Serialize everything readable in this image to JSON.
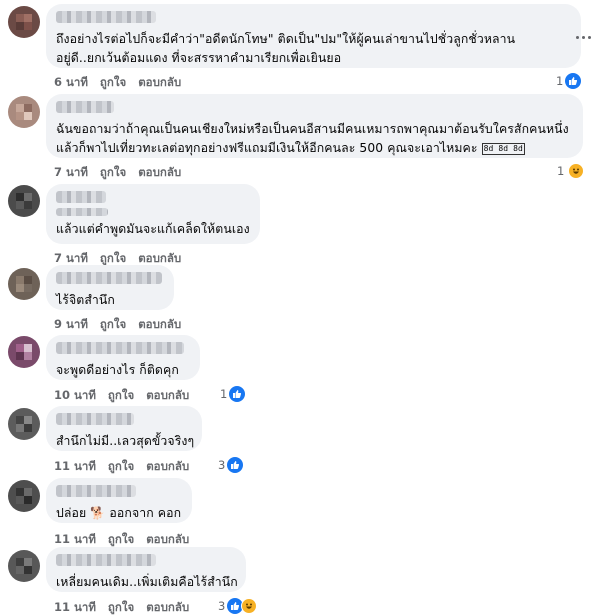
{
  "colors": {
    "bubble": "#f0f2f5",
    "meta": "#65676b",
    "like": "#1877f2",
    "haha": "#f7b125"
  },
  "comments": [
    {
      "lines": [
        "ถึงอย่างไรต่อไปก็จะมีคำว่า\"อดีตนักโทษ\" ติดเป็น\"ปม\"ให้ผู้คนเล่าขานไปชั่วลูกชั่วหลาน",
        "อยู่ดี..ยกเว้นต้อมแดง ที่จะสรรหาคำมาเรียกเพื่อเยินยอ"
      ],
      "time": "6 นาที",
      "like": "ถูกใจ",
      "reply": "ตอบกลับ",
      "reactions": "1",
      "reaction_icons": [
        "like-icon"
      ]
    },
    {
      "lines": [
        "ฉันขอถามว่าถ้าคุณเป็นคนเชียงใหม่หรือเป็นคนอีสานมีคนเหมารถพาคุณมาต้อนรับใครสักคนหนึ่ง",
        "แล้วก็พาไปเที่ยวทะเลต่อทุกอย่างฟรีแถมมีเงินให้อีกคนละ 500 คุณจะเอาไหมคะ"
      ],
      "glyph": "8d 8d 8d",
      "time": "7 นาที",
      "like": "ถูกใจ",
      "reply": "ตอบกลับ",
      "reactions": "1",
      "reaction_icons": [
        "haha-icon"
      ]
    },
    {
      "lines": [
        "แล้วแต่คำพูดมันจะแก้เคล็ดให้ตนเอง"
      ],
      "time": "7 นาที",
      "like": "ถูกใจ",
      "reply": "ตอบกลับ",
      "reactions": "",
      "reaction_icons": []
    },
    {
      "lines": [
        "ไร้จิตสำนึก"
      ],
      "time": "9 นาที",
      "like": "ถูกใจ",
      "reply": "ตอบกลับ",
      "reactions": "",
      "reaction_icons": []
    },
    {
      "lines": [
        "จะพูดดีอย่างไร ก็ติดคุก"
      ],
      "time": "10 นาที",
      "like": "ถูกใจ",
      "reply": "ตอบกลับ",
      "reactions": "1",
      "reaction_icons": [
        "like-icon"
      ]
    },
    {
      "lines": [
        "สำนึกไม่มี..เลวสุดขั้วจริงๆ"
      ],
      "time": "11 นาที",
      "like": "ถูกใจ",
      "reply": "ตอบกลับ",
      "reactions": "3",
      "reaction_icons": [
        "like-icon"
      ]
    },
    {
      "lines_a": "ปล่อย",
      "dog_icon": "🐕",
      "lines_b": "ออกจาก คอก",
      "time": "11 นาที",
      "like": "ถูกใจ",
      "reply": "ตอบกลับ",
      "reactions": "",
      "reaction_icons": []
    },
    {
      "lines": [
        "เหลี่ยมคนเดิม..เพิ่มเติมคือไร้สำนึก"
      ],
      "time": "11 นาที",
      "like": "ถูกใจ",
      "reply": "ตอบกลับ",
      "reactions": "3",
      "reaction_icons": [
        "like-icon",
        "haha-icon"
      ]
    }
  ]
}
